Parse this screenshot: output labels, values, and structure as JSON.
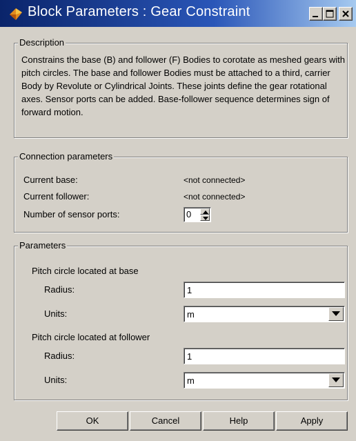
{
  "window": {
    "title": "Block Parameters : Gear Constraint",
    "controls": {
      "minimize": "minimize",
      "maximize": "maximize",
      "close": "close"
    }
  },
  "description": {
    "legend": "Description",
    "text": "Constrains the base (B) and follower (F) Bodies to corotate as meshed gears with pitch circles. The base and follower Bodies must be attached to a third, carrier Body by Revolute or Cylindrical Joints. These joints define the gear rotational axes. Sensor ports can be added. Base-follower sequence determines sign of forward motion."
  },
  "connection": {
    "legend": "Connection parameters",
    "base_label": "Current base:",
    "base_value": "<not connected>",
    "follower_label": "Current follower:",
    "follower_value": "<not connected>",
    "sensor_label": "Number of sensor ports:",
    "sensor_value": "0"
  },
  "parameters": {
    "legend": "Parameters",
    "base_heading": "Pitch circle located at base",
    "base_radius_label": "Radius:",
    "base_radius_value": "1",
    "base_units_label": "Units:",
    "base_units_value": "m",
    "follower_heading": "Pitch circle located at follower",
    "follower_radius_label": "Radius:",
    "follower_radius_value": "1",
    "follower_units_label": "Units:",
    "follower_units_value": "m"
  },
  "buttons": {
    "ok": "OK",
    "cancel": "Cancel",
    "help": "Help",
    "apply": "Apply"
  },
  "icons": {
    "app": "simulink-block-icon",
    "minimize": "minimize-icon",
    "maximize": "maximize-icon",
    "close": "close-icon",
    "dropdown": "chevron-down-icon",
    "spin_up": "arrow-up-icon",
    "spin_down": "arrow-down-icon"
  }
}
